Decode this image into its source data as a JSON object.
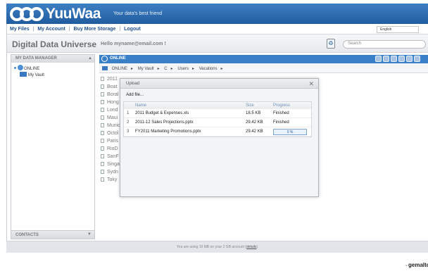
{
  "app": {
    "brand": "YuuWaa",
    "tagline": "Your data's best friend",
    "site_title": "Digital Data Universe",
    "greeting": "Hello myname@email.com !",
    "vendor_mark": "gemalto",
    "vendor_prefix": "™"
  },
  "menu": {
    "items": [
      "My Files",
      "My Account",
      "Buy More Storage",
      "Logout"
    ],
    "separator": "|"
  },
  "language": {
    "selected": "English"
  },
  "search": {
    "placeholder": "Search"
  },
  "sidebar": {
    "header": "MY DATA MANAGER",
    "tree": [
      {
        "label": "ONLINE"
      },
      {
        "label": "My Vault"
      }
    ],
    "contacts_label": "CONTACTS"
  },
  "pane": {
    "title": "ONLINE",
    "breadcrumb": [
      "ONLINE",
      "My Vault",
      "C",
      "Users",
      "Vacations"
    ],
    "crumb_separator": "▸"
  },
  "files": [
    "2011",
    "Boat",
    "Boral",
    "Hong",
    "Lond",
    "Maui",
    "Munic",
    "Octol",
    "Paris",
    "RioD",
    "SanF",
    "Singa",
    "Sydn",
    "Toky"
  ],
  "upload_dialog": {
    "title": "Upload",
    "close_glyph": "✕",
    "add_file_label": "Add file...",
    "columns": {
      "name": "Name",
      "size": "Size",
      "progress": "Progress"
    },
    "rows": [
      {
        "num": "1",
        "name": "2011 Budget & Expenses.xls",
        "size": "18.5 KB",
        "status": "Finished"
      },
      {
        "num": "2",
        "name": "2011-12 Sales Projections.pptx",
        "size": "29.42 KB",
        "status": "Finished"
      },
      {
        "num": "3",
        "name": "FY2011 Marketing Promotions.pptx",
        "size": "29.42 KB",
        "status": "",
        "progress_text": "0 %",
        "progress": 0
      }
    ]
  },
  "footer": {
    "usage_text": "You are using 16 MB on your 2 GB account",
    "details_label": "details"
  },
  "colors": {
    "brand_blue": "#3e7fc4",
    "menu_link": "#1f4f8a",
    "pane_blue": "#3a80c8"
  }
}
